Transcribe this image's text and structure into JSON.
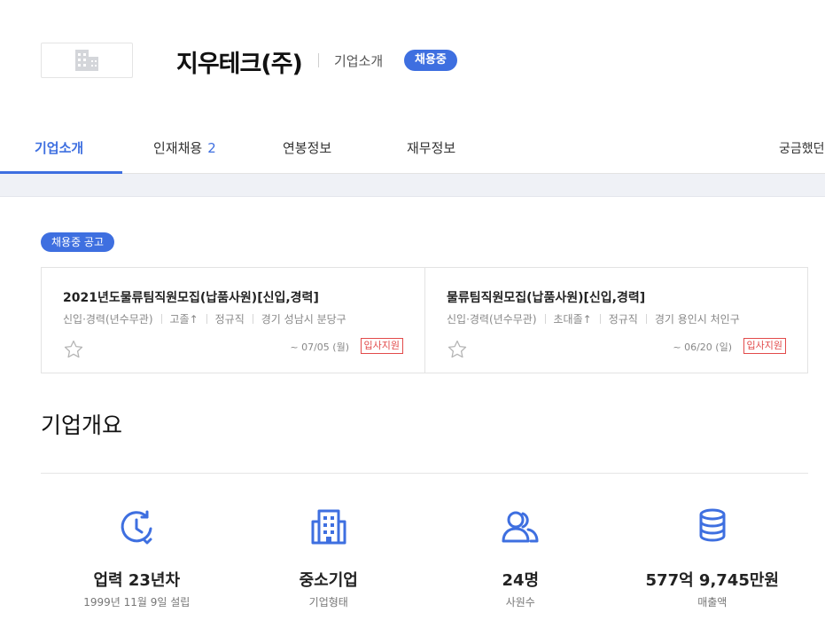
{
  "header": {
    "company_name": "지우테크(주)",
    "subtitle": "기업소개",
    "status_badge": "채용중"
  },
  "tabs": [
    {
      "label": "기업소개",
      "active": true
    },
    {
      "label": "인재채용",
      "count": "2"
    },
    {
      "label": "연봉정보"
    },
    {
      "label": "재무정보"
    },
    {
      "label": "궁금했던"
    }
  ],
  "jobs_section": {
    "badge": "채용중 공고",
    "jobs": [
      {
        "title": "2021년도물류팀직원모집(납품사원)[신입,경력]",
        "meta": [
          "신입·경력(년수무관)",
          "고졸↑",
          "정규직",
          "경기 성남시 분당구"
        ],
        "deadline": "~ 07/05 (월)",
        "apply_label": "입사지원"
      },
      {
        "title": "물류팀직원모집(납품사원)[신입,경력]",
        "meta": [
          "신입·경력(년수무관)",
          "초대졸↑",
          "정규직",
          "경기 용인시 처인구"
        ],
        "deadline": "~ 06/20 (일)",
        "apply_label": "입사지원"
      }
    ]
  },
  "overview": {
    "title": "기업개요",
    "stats": [
      {
        "icon": "clock-history-icon",
        "value": "업력 23년차",
        "label": "1999년 11월 9일 설립"
      },
      {
        "icon": "building-icon",
        "value": "중소기업",
        "label": "기업형태"
      },
      {
        "icon": "users-icon",
        "value": "24명",
        "label": "사원수"
      },
      {
        "icon": "coins-icon",
        "value": "577억 9,745만원",
        "label": "매출액"
      }
    ]
  },
  "colors": {
    "accent": "#3e6fe0",
    "apply_red": "#e24b4b",
    "band_gray": "#eff1f6"
  }
}
